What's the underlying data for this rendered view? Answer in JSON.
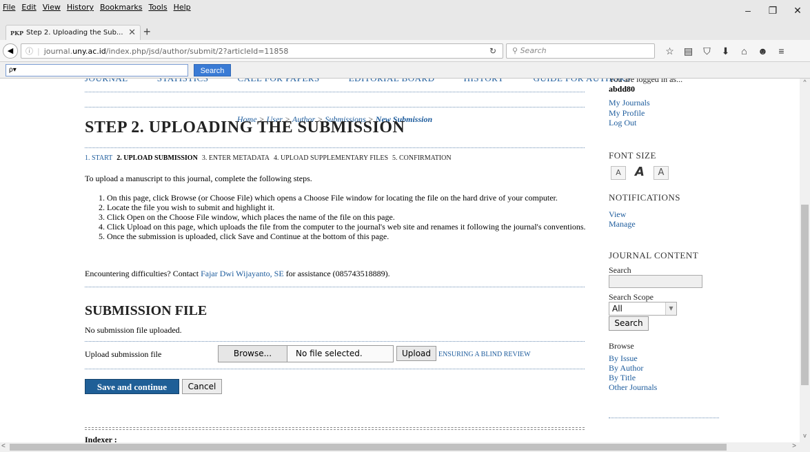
{
  "menubar": {
    "items": [
      "File",
      "Edit",
      "View",
      "History",
      "Bookmarks",
      "Tools",
      "Help"
    ]
  },
  "window_controls": {
    "minimize": "–",
    "restore": "❐",
    "close": "✕"
  },
  "tab": {
    "favicon_text": "PKP",
    "title": "Step 2. Uploading the Sub...",
    "close": "✕",
    "new_tab": "+"
  },
  "nav": {
    "url_prefix": "journal.",
    "url_domain": "uny.ac.id",
    "url_rest": "/index.php/jsd/author/submit/2?articleId=11858",
    "search_placeholder": "Search",
    "icons": [
      "star-icon",
      "reading-list-icon",
      "pocket-icon",
      "download-icon",
      "home-icon",
      "smiley-icon",
      "hamburger-menu-icon"
    ]
  },
  "findbar": {
    "placeholder": "ρ▾",
    "button": "Search"
  },
  "page": {
    "top_nav": [
      "JOURNAL",
      "STATISTICS",
      "CALL FOR PAPERS",
      "EDITORIAL BOARD",
      "HISTORY",
      "GUIDE FOR AUTHORS"
    ],
    "breadcrumb": [
      "Home",
      "User",
      "Author",
      "Submissions",
      "New Submission"
    ],
    "breadcrumb_sep": " > ",
    "title": "STEP 2. UPLOADING THE SUBMISSION",
    "steps": [
      {
        "label": "1. START",
        "state": "link"
      },
      {
        "label": "2. UPLOAD SUBMISSION",
        "state": "current"
      },
      {
        "label": "3. ENTER METADATA",
        "state": "plain"
      },
      {
        "label": "4. UPLOAD SUPPLEMENTARY FILES",
        "state": "plain"
      },
      {
        "label": "5. CONFIRMATION",
        "state": "plain"
      }
    ],
    "intro": "To upload a manuscript to this journal, complete the following steps.",
    "instructions": [
      "On this page, click Browse (or Choose File) which opens a Choose File window for locating the file on the hard drive of your computer.",
      "Locate the file you wish to submit and highlight it.",
      "Click Open on the Choose File window, which places the name of the file on this page.",
      "Click Upload on this page, which uploads the file from the computer to the journal's web site and renames it following the journal's conventions.",
      "Once the submission is uploaded, click Save and Continue at the bottom of this page."
    ],
    "contact_pre": "Encountering difficulties? Contact ",
    "contact_name": "Fajar Dwi Wijayanto, SE",
    "contact_post": " for assistance (085743518889).",
    "section_title": "SUBMISSION FILE",
    "no_file": "No submission file uploaded.",
    "upload_label": "Upload submission file",
    "browse_button": "Browse...",
    "file_value": "No file selected.",
    "upload_button": "Upload",
    "blind_review_link": "ENSURING A BLIND REVIEW",
    "save_button": "Save and continue",
    "cancel_button": "Cancel",
    "indexer": "Indexer :"
  },
  "sidebar": {
    "logged_in_as": "You are logged in as...",
    "username": "abdd80",
    "user_links": [
      "My Journals",
      "My Profile",
      "Log Out"
    ],
    "font_size_heading": "FONT SIZE",
    "font_size_buttons": [
      "A",
      "A",
      "A"
    ],
    "notifications_heading": "NOTIFICATIONS",
    "notification_links": [
      "View",
      "Manage"
    ],
    "journal_content_heading": "JOURNAL CONTENT",
    "search_label": "Search",
    "search_scope_label": "Search Scope",
    "search_scope_value": "All",
    "search_button": "Search",
    "browse_label": "Browse",
    "browse_links": [
      "By Issue",
      "By Author",
      "By Title",
      "Other Journals"
    ]
  },
  "scrollbar": {
    "up": "^",
    "down": "v",
    "left": "<",
    "right": ">"
  }
}
